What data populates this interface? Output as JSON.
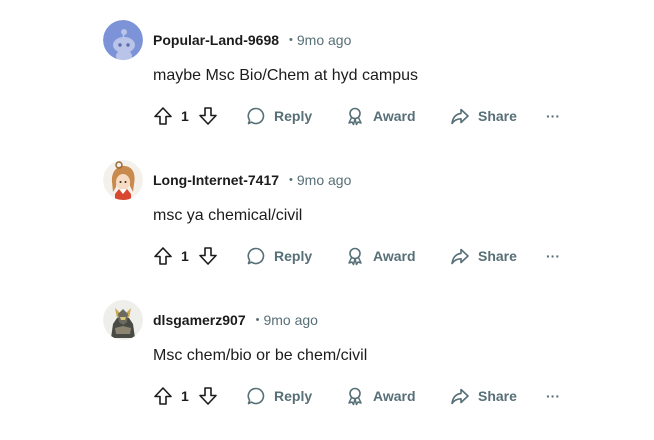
{
  "comments": [
    {
      "username": "Popular-Land-9698",
      "separator": "•",
      "time": "9mo ago",
      "body": "maybe Msc Bio/Chem at hyd campus",
      "votes": "1",
      "avatar": "snoo-default-avatar"
    },
    {
      "username": "Long-Internet-7417",
      "separator": "•",
      "time": "9mo ago",
      "body": "msc ya chemical/civil",
      "votes": "1",
      "avatar": "anime-character-avatar"
    },
    {
      "username": "dlsgamerz907",
      "separator": "•",
      "time": "9mo ago",
      "body": "Msc chem/bio or be chem/civil",
      "votes": "1",
      "avatar": "armored-character-avatar"
    }
  ],
  "actions": {
    "reply": "Reply",
    "award": "Award",
    "share": "Share",
    "more": "···"
  },
  "colors": {
    "meta_gray": "#576f76",
    "text": "#1c1c1c",
    "snoo_blue": "#7d93d8"
  }
}
